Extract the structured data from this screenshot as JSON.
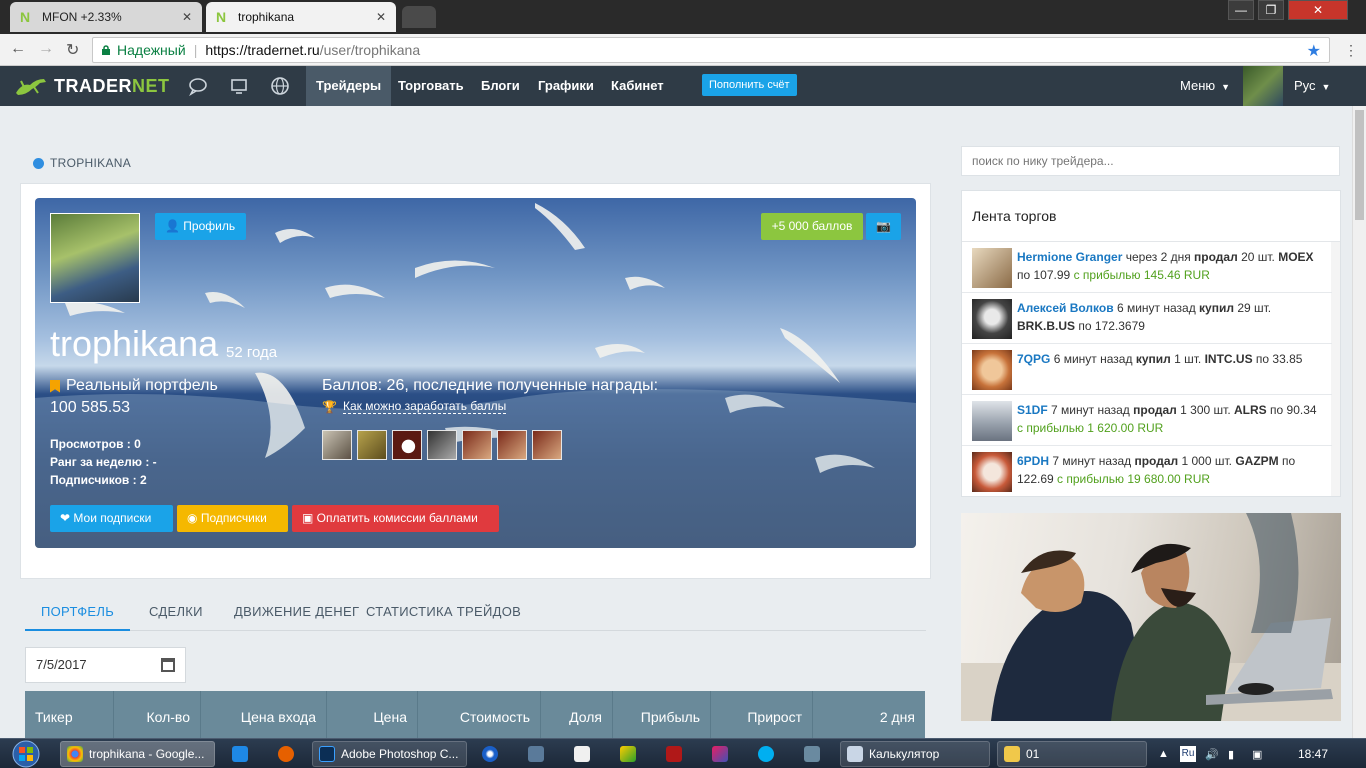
{
  "browser": {
    "tabs": [
      {
        "title": "MFON +2.33%",
        "close": "✕"
      },
      {
        "title": "trophikana",
        "close": "✕"
      }
    ],
    "secure_label": "Надежный",
    "url_host": "https://tradernet.ru",
    "url_path": "/user/trophikana"
  },
  "sitenav": {
    "logo_part1": "TRADER",
    "logo_part2": "NET",
    "links": [
      "Трейдеры",
      "Торговать",
      "Блоги",
      "Графики",
      "Кабинет"
    ],
    "topup_label": "Пополнить счёт",
    "menu_label": "Меню",
    "lang_label": "Рус"
  },
  "breadcrumb": "TROPHIKANA",
  "profile": {
    "profile_button": "Профиль",
    "bonus_button": "+5 000 баллов",
    "username": "trophikana",
    "age": "52 года",
    "portfolio_type": "Реальный портфель",
    "portfolio_value": "100 585.53",
    "stats": [
      {
        "label": "Просмотров :",
        "value": "0"
      },
      {
        "label": "Ранг за неделю :",
        "value": "-"
      },
      {
        "label": "Подписчиков :",
        "value": "2"
      }
    ],
    "points_text": "Баллов: 26, последние полученные награды:",
    "howto_link": "Как можно заработать баллы",
    "buttons": {
      "subscriptions": "Мои подписки",
      "followers": "Подписчики",
      "pay_commission": "Оплатить комиссии баллами"
    }
  },
  "tabs": [
    "ПОРТФЕЛЬ",
    "СДЕЛКИ",
    "ДВИЖЕНИЕ ДЕНЕГ",
    "СТАТИСТИКА ТРЕЙДОВ"
  ],
  "date_value": "7/5/2017",
  "table_headers": [
    "Тикер",
    "Кол-во",
    "Цена входа",
    "Цена",
    "Стоимость",
    "Доля",
    "Прибыль",
    "Прирост",
    "2 дня"
  ],
  "sidebar": {
    "search_placeholder": "поиск по нику трейдера...",
    "feed_title": "Лента торгов",
    "feed": [
      {
        "who": "Hermione Granger",
        "when": "через 2 дня",
        "action": "продал",
        "qty": "20 шт.",
        "ticker": "MOEX",
        "price": "по 107.99",
        "profit": "с прибылью 145.46 RUR",
        "avatar_color": "#b89a6e"
      },
      {
        "who": "Алексей Волков",
        "when": "6 минут назад",
        "action": "купил",
        "qty": "29 шт.",
        "ticker": "BRK.B.US",
        "price": "по 172.3679",
        "profit": "",
        "avatar_color": "#5a6068"
      },
      {
        "who": "7QPG",
        "when": "6 минут назад",
        "action": "купил",
        "qty": "1 шт.",
        "ticker": "INTC.US",
        "price": "по 33.85",
        "profit": "",
        "avatar_color": "#c7723a"
      },
      {
        "who": "S1DF",
        "when": "7 минут назад",
        "action": "продал",
        "qty": "1 300 шт.",
        "ticker": "ALRS",
        "price": "по 90.34",
        "profit": "с прибылью 1 620.00 RUR",
        "avatar_color": "#9aa3ae"
      },
      {
        "who": "6PDH",
        "when": "7 минут назад",
        "action": "продал",
        "qty": "1 000 шт.",
        "ticker": "GAZPM",
        "price": "по 122.69",
        "profit": "с прибылью 19 680.00 RUR",
        "avatar_color": "#c85a3a"
      }
    ]
  },
  "taskbar": {
    "items": [
      "trophikana - Google...",
      "Adobe Photoshop C...",
      "Калькулятор",
      "01"
    ],
    "lang": "Ru",
    "time": "18:47"
  }
}
